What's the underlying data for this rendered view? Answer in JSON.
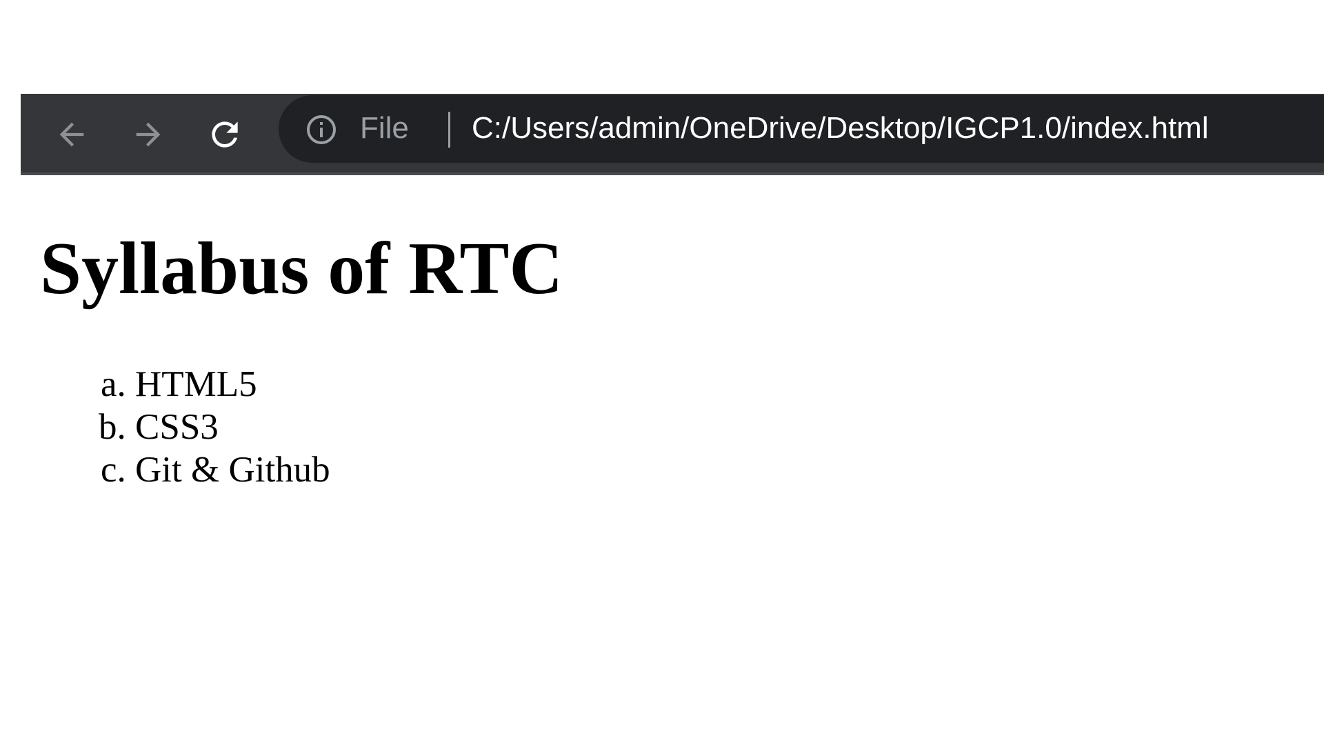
{
  "browser": {
    "toolbar": {
      "back_icon": "arrow-left-icon",
      "forward_icon": "arrow-right-icon",
      "reload_icon": "reload-icon"
    },
    "omnibox": {
      "info_icon": "info-icon",
      "scheme_label": "File",
      "url": "C:/Users/admin/OneDrive/Desktop/IGCP1.0/index.html"
    },
    "colors": {
      "toolbar_bg": "#35363a",
      "omnibox_bg": "#202124",
      "dim_icon": "#8e9094",
      "url_text": "#ffffff"
    }
  },
  "page": {
    "title": "Syllabus of RTC",
    "list_style": "lower-alpha",
    "items": [
      {
        "text": "HTML5"
      },
      {
        "text": "CSS3"
      },
      {
        "text": "Git & Github"
      }
    ]
  }
}
